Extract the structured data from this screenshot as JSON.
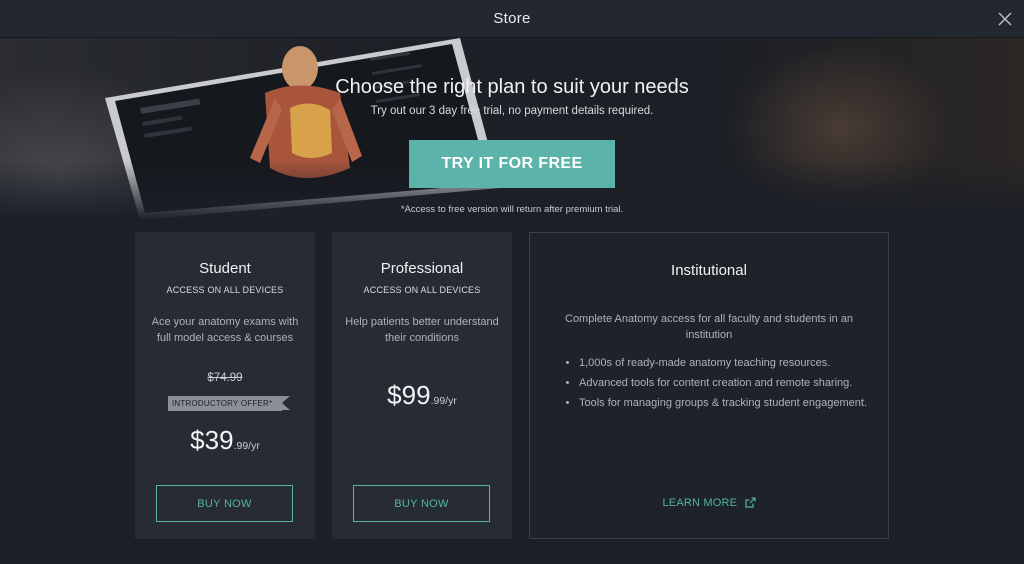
{
  "window": {
    "title": "Store"
  },
  "hero": {
    "headline": "Choose the right plan to suit your needs",
    "subline": "Try out our 3 day free trial, no payment details required.",
    "cta_label": "TRY IT FOR FREE",
    "note": "*Access to free version will return after premium trial."
  },
  "plans": {
    "student": {
      "name": "Student",
      "devices": "ACCESS ON ALL DEVICES",
      "desc": "Ace your anatomy exams with full model access & courses",
      "old_price": "$74.99",
      "offer": "INTRODUCTORY OFFER*",
      "price_main": "$39",
      "price_cents": ".99/yr",
      "buy_label": "BUY NOW"
    },
    "professional": {
      "name": "Professional",
      "devices": "ACCESS ON ALL DEVICES",
      "desc": "Help patients better understand their conditions",
      "price_main": "$99",
      "price_cents": ".99/yr",
      "buy_label": "BUY NOW"
    },
    "institutional": {
      "name": "Institutional",
      "desc": "Complete Anatomy access for all faculty and students in an institution",
      "features": [
        "1,000s of ready-made anatomy teaching resources.",
        "Advanced tools for content creation and remote sharing.",
        "Tools for managing groups & tracking student engagement."
      ],
      "learn_more": "LEARN MORE"
    }
  },
  "icons": {
    "close": "close-icon",
    "external": "external-link-icon"
  },
  "colors": {
    "accent": "#5bb3a9",
    "background": "#1b1f27",
    "card": "#272b34"
  }
}
